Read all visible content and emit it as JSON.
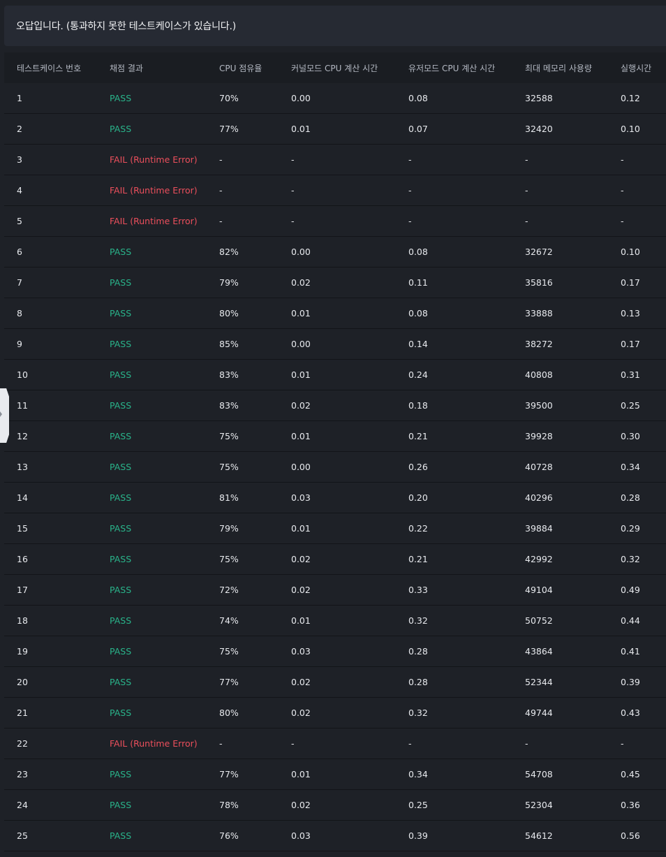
{
  "banner": {
    "message": "오답입니다. (통과하지 못한 테스트케이스가 있습니다.)"
  },
  "table": {
    "headers": [
      "테스트케이스 번호",
      "채점 결과",
      "CPU 점유율",
      "커널모드 CPU 계산 시간",
      "유저모드 CPU 계산 시간",
      "최대 메모리 사용량",
      "실행시간"
    ],
    "rows": [
      [
        "1",
        "PASS",
        "70%",
        "0.00",
        "0.08",
        "32588",
        "0.12"
      ],
      [
        "2",
        "PASS",
        "77%",
        "0.01",
        "0.07",
        "32420",
        "0.10"
      ],
      [
        "3",
        "FAIL (Runtime Error)",
        "-",
        "-",
        "-",
        "-",
        "-"
      ],
      [
        "4",
        "FAIL (Runtime Error)",
        "-",
        "-",
        "-",
        "-",
        "-"
      ],
      [
        "5",
        "FAIL (Runtime Error)",
        "-",
        "-",
        "-",
        "-",
        "-"
      ],
      [
        "6",
        "PASS",
        "82%",
        "0.00",
        "0.08",
        "32672",
        "0.10"
      ],
      [
        "7",
        "PASS",
        "79%",
        "0.02",
        "0.11",
        "35816",
        "0.17"
      ],
      [
        "8",
        "PASS",
        "80%",
        "0.01",
        "0.08",
        "33888",
        "0.13"
      ],
      [
        "9",
        "PASS",
        "85%",
        "0.00",
        "0.14",
        "38272",
        "0.17"
      ],
      [
        "10",
        "PASS",
        "83%",
        "0.01",
        "0.24",
        "40808",
        "0.31"
      ],
      [
        "11",
        "PASS",
        "83%",
        "0.02",
        "0.18",
        "39500",
        "0.25"
      ],
      [
        "12",
        "PASS",
        "75%",
        "0.01",
        "0.21",
        "39928",
        "0.30"
      ],
      [
        "13",
        "PASS",
        "75%",
        "0.00",
        "0.26",
        "40728",
        "0.34"
      ],
      [
        "14",
        "PASS",
        "81%",
        "0.03",
        "0.20",
        "40296",
        "0.28"
      ],
      [
        "15",
        "PASS",
        "79%",
        "0.01",
        "0.22",
        "39884",
        "0.29"
      ],
      [
        "16",
        "PASS",
        "75%",
        "0.02",
        "0.21",
        "42992",
        "0.32"
      ],
      [
        "17",
        "PASS",
        "72%",
        "0.02",
        "0.33",
        "49104",
        "0.49"
      ],
      [
        "18",
        "PASS",
        "74%",
        "0.01",
        "0.32",
        "50752",
        "0.44"
      ],
      [
        "19",
        "PASS",
        "75%",
        "0.03",
        "0.28",
        "43864",
        "0.41"
      ],
      [
        "20",
        "PASS",
        "77%",
        "0.02",
        "0.28",
        "52344",
        "0.39"
      ],
      [
        "21",
        "PASS",
        "80%",
        "0.02",
        "0.32",
        "49744",
        "0.43"
      ],
      [
        "22",
        "FAIL (Runtime Error)",
        "-",
        "-",
        "-",
        "-",
        "-"
      ],
      [
        "23",
        "PASS",
        "77%",
        "0.01",
        "0.34",
        "54708",
        "0.45"
      ],
      [
        "24",
        "PASS",
        "78%",
        "0.02",
        "0.25",
        "52304",
        "0.36"
      ],
      [
        "25",
        "PASS",
        "76%",
        "0.03",
        "0.39",
        "54612",
        "0.56"
      ]
    ]
  },
  "colors": {
    "pass": "#29b38a",
    "fail": "#ec4f5c"
  },
  "side_tab": {
    "icon": "chevron-left-icon"
  }
}
